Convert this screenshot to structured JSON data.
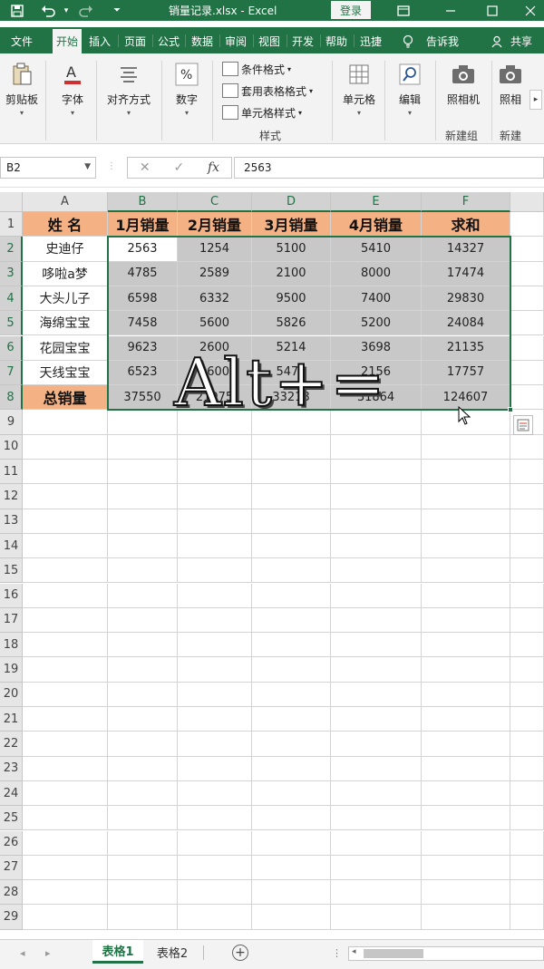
{
  "titlebar": {
    "title": "销量记录.xlsx  -  Excel",
    "login": "登录",
    "icons": [
      "save-icon",
      "undo-icon",
      "redo-icon",
      "customize-qat-icon",
      "ribbon-display-icon",
      "minimize-icon",
      "restore-icon",
      "close-icon"
    ]
  },
  "tabs": [
    "文件",
    "开始",
    "插入",
    "页面",
    "公式",
    "数据",
    "审阅",
    "视图",
    "开发",
    "帮助",
    "迅捷",
    "告诉我",
    "共享"
  ],
  "ribbon": {
    "clipboard": "剪贴板",
    "font": "字体",
    "alignment": "对齐方式",
    "number": "数字",
    "conditional_format": "条件格式",
    "table_format": "套用表格格式",
    "cell_style": "单元格样式",
    "styles_group": "样式",
    "cells": "单元格",
    "editing": "编辑",
    "camera": "照相机",
    "new_group": "新建组",
    "camera2": "照相",
    "new_group2": "新建"
  },
  "formula_bar": {
    "name_box": "B2",
    "formula": "2563",
    "cancel": "✕",
    "enter": "✓",
    "fx": "fx"
  },
  "columns": [
    "A",
    "B",
    "C",
    "D",
    "E",
    "F"
  ],
  "rows": [
    "1",
    "2",
    "3",
    "4",
    "5",
    "6",
    "7",
    "8",
    "9",
    "10",
    "11",
    "12",
    "13",
    "14",
    "15",
    "16",
    "17",
    "18",
    "19",
    "20",
    "21",
    "22",
    "23",
    "24",
    "25",
    "26",
    "27",
    "28",
    "29"
  ],
  "table": {
    "header": [
      "姓 名",
      "1月销量",
      "2月销量",
      "3月销量",
      "4月销量",
      "求和"
    ],
    "rows": [
      [
        "史迪仔",
        "2563",
        "1254",
        "5100",
        "5410",
        "14327"
      ],
      [
        "哆啦a梦",
        "4785",
        "2589",
        "2100",
        "8000",
        "17474"
      ],
      [
        "大头儿子",
        "6598",
        "6332",
        "9500",
        "7400",
        "29830"
      ],
      [
        "海绵宝宝",
        "7458",
        "5600",
        "5826",
        "5200",
        "24084"
      ],
      [
        "花园宝宝",
        "9623",
        "2600",
        "5214",
        "3698",
        "21135"
      ],
      [
        "天线宝宝",
        "6523",
        "3600",
        "5478",
        "2156",
        "17757"
      ]
    ],
    "total": [
      "总销量",
      "37550",
      "21975",
      "33218",
      "31864",
      "124607"
    ]
  },
  "overlay": "Alt+=",
  "sheets": [
    "表格1",
    "表格2"
  ]
}
